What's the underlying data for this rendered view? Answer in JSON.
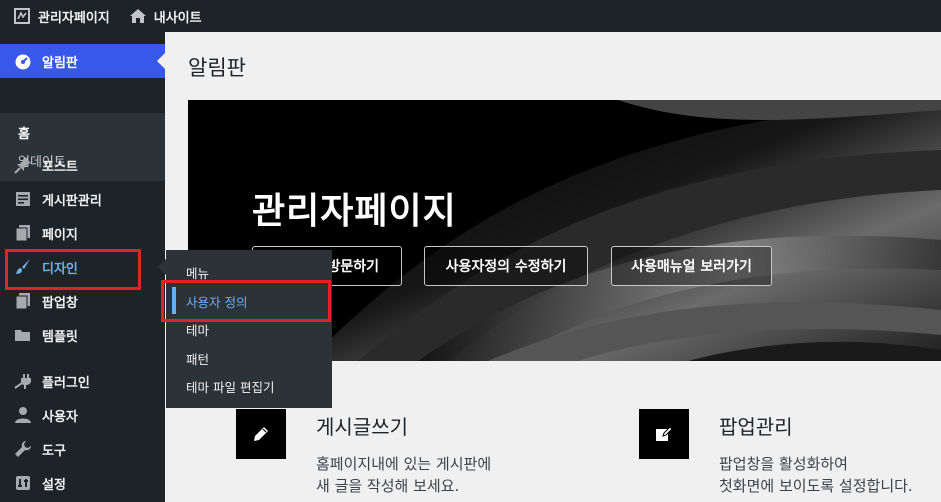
{
  "adminbar": {
    "site_admin_label": "관리자페이지",
    "my_site_label": "내사이트"
  },
  "sidebar": {
    "dashboard_label": "알림판",
    "dashboard_sub": [
      "홈",
      "업데이트"
    ],
    "items": [
      {
        "label": "포스트",
        "icon": "pin-icon"
      },
      {
        "label": "게시판관리",
        "icon": "board-icon"
      },
      {
        "label": "페이지",
        "icon": "page-icon"
      },
      {
        "label": "디자인",
        "icon": "brush-icon"
      },
      {
        "label": "팝업창",
        "icon": "popup-icon"
      },
      {
        "label": "템플릿",
        "icon": "folder-icon"
      },
      {
        "label": "플러그인",
        "icon": "plug-icon"
      },
      {
        "label": "사용자",
        "icon": "user-icon"
      },
      {
        "label": "도구",
        "icon": "wrench-icon"
      },
      {
        "label": "설정",
        "icon": "settings-icon"
      }
    ]
  },
  "flyout": {
    "items": [
      "메뉴",
      "사용자 정의",
      "테마",
      "패턴",
      "테마 파일 편집기"
    ],
    "active_index": 1
  },
  "main": {
    "page_title": "알림판",
    "hero": {
      "title": "관리자페이지",
      "buttons": [
        "방문하기",
        "사용자정의 수정하기",
        "사용매뉴얼 보러가기"
      ]
    },
    "cards": [
      {
        "title": "게시글쓰기",
        "desc_line1": "홈페이지내에 있는 게시판에",
        "desc_line2": "새 글을 작성해 보세요.",
        "icon": "pencil-icon"
      },
      {
        "title": "팝업관리",
        "desc_line1": "팝업창을 활성화하여",
        "desc_line2": "첫화면에 보이도록 설정합니다.",
        "icon": "edit-icon"
      }
    ]
  },
  "colors": {
    "adminbar_bg": "#1d2327",
    "sidebar_bg": "#1d2327",
    "current_menu": "#3858e9",
    "highlight_red": "#e02424",
    "submenu_active": "#72aee6"
  }
}
